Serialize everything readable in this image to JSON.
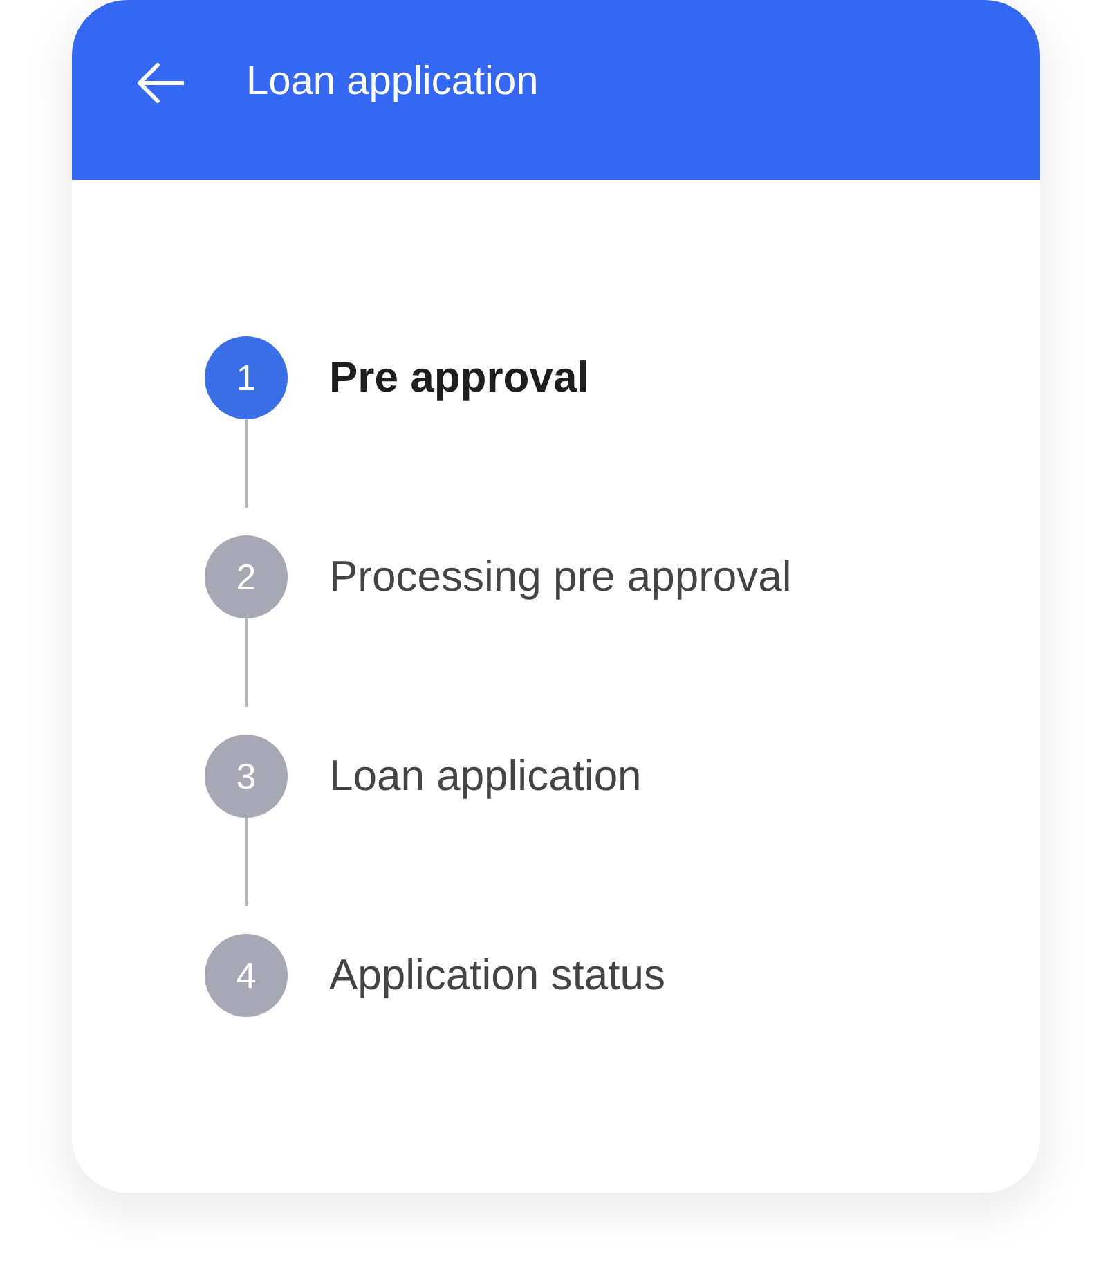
{
  "header": {
    "title": "Loan application"
  },
  "steps": [
    {
      "number": "1",
      "label": "Pre approval",
      "selected": true
    },
    {
      "number": "2",
      "label": "Processing pre approval",
      "selected": false
    },
    {
      "number": "3",
      "label": "Loan application",
      "selected": false
    },
    {
      "number": "4",
      "label": "Application status",
      "selected": false
    }
  ]
}
